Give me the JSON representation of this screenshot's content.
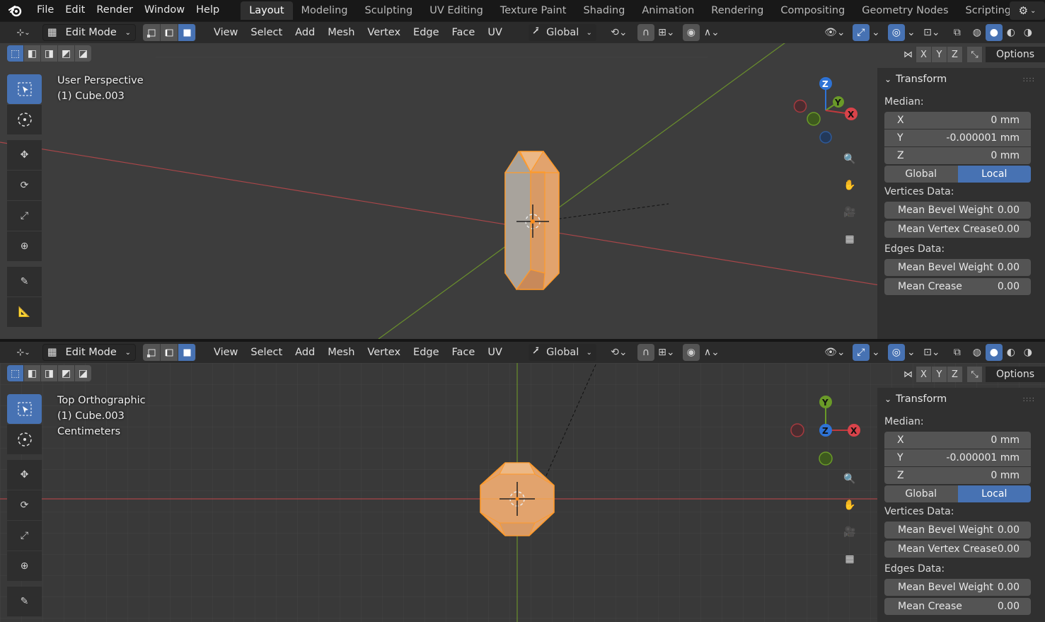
{
  "topbar": {
    "menus": [
      "File",
      "Edit",
      "Render",
      "Window",
      "Help"
    ],
    "workspaces": [
      "Layout",
      "Modeling",
      "Sculpting",
      "UV Editing",
      "Texture Paint",
      "Shading",
      "Animation",
      "Rendering",
      "Compositing",
      "Geometry Nodes",
      "Scripting"
    ],
    "active_workspace": "Layout",
    "plus": "+"
  },
  "header": {
    "mode": "Edit Mode",
    "menus": [
      "View",
      "Select",
      "Add",
      "Mesh",
      "Vertex",
      "Edge",
      "Face",
      "UV"
    ],
    "orientation": "Global",
    "options_label": "Options",
    "axes": [
      "X",
      "Y",
      "Z"
    ]
  },
  "top_view": {
    "info": [
      "User Perspective",
      "(1) Cube.003"
    ],
    "gizmo": {
      "x": "X",
      "y": "Y",
      "z": "Z"
    }
  },
  "bottom_view": {
    "info": [
      "Top Orthographic",
      "(1) Cube.003",
      "Centimeters"
    ],
    "gizmo": {
      "x": "X",
      "y": "Y",
      "z": "Z"
    }
  },
  "npanel": {
    "title": "Transform",
    "median_label": "Median:",
    "x_label": "X",
    "x_value": "0 mm",
    "y_label": "Y",
    "y_value": "-0.000001 mm",
    "z_label": "Z",
    "z_value": "0 mm",
    "global_label": "Global",
    "local_label": "Local",
    "vertices_label": "Vertices Data:",
    "mean_bevel_weight": "Mean Bevel Weight",
    "mean_bevel_weight_v": "0.00",
    "mean_vertex_crease": "Mean Vertex Crease",
    "mean_vertex_crease_v": "0.00",
    "edges_label": "Edges Data:",
    "edge_bevel_weight": "Mean Bevel Weight",
    "edge_bevel_weight_v": "0.00",
    "mean_crease": "Mean Crease",
    "mean_crease_v": "0.00"
  },
  "colors": {
    "accent": "#4772b3",
    "selection": "#ffa030",
    "x_axis": "#c0393d",
    "y_axis": "#6a9a28",
    "z_axis": "#2e73d6"
  }
}
